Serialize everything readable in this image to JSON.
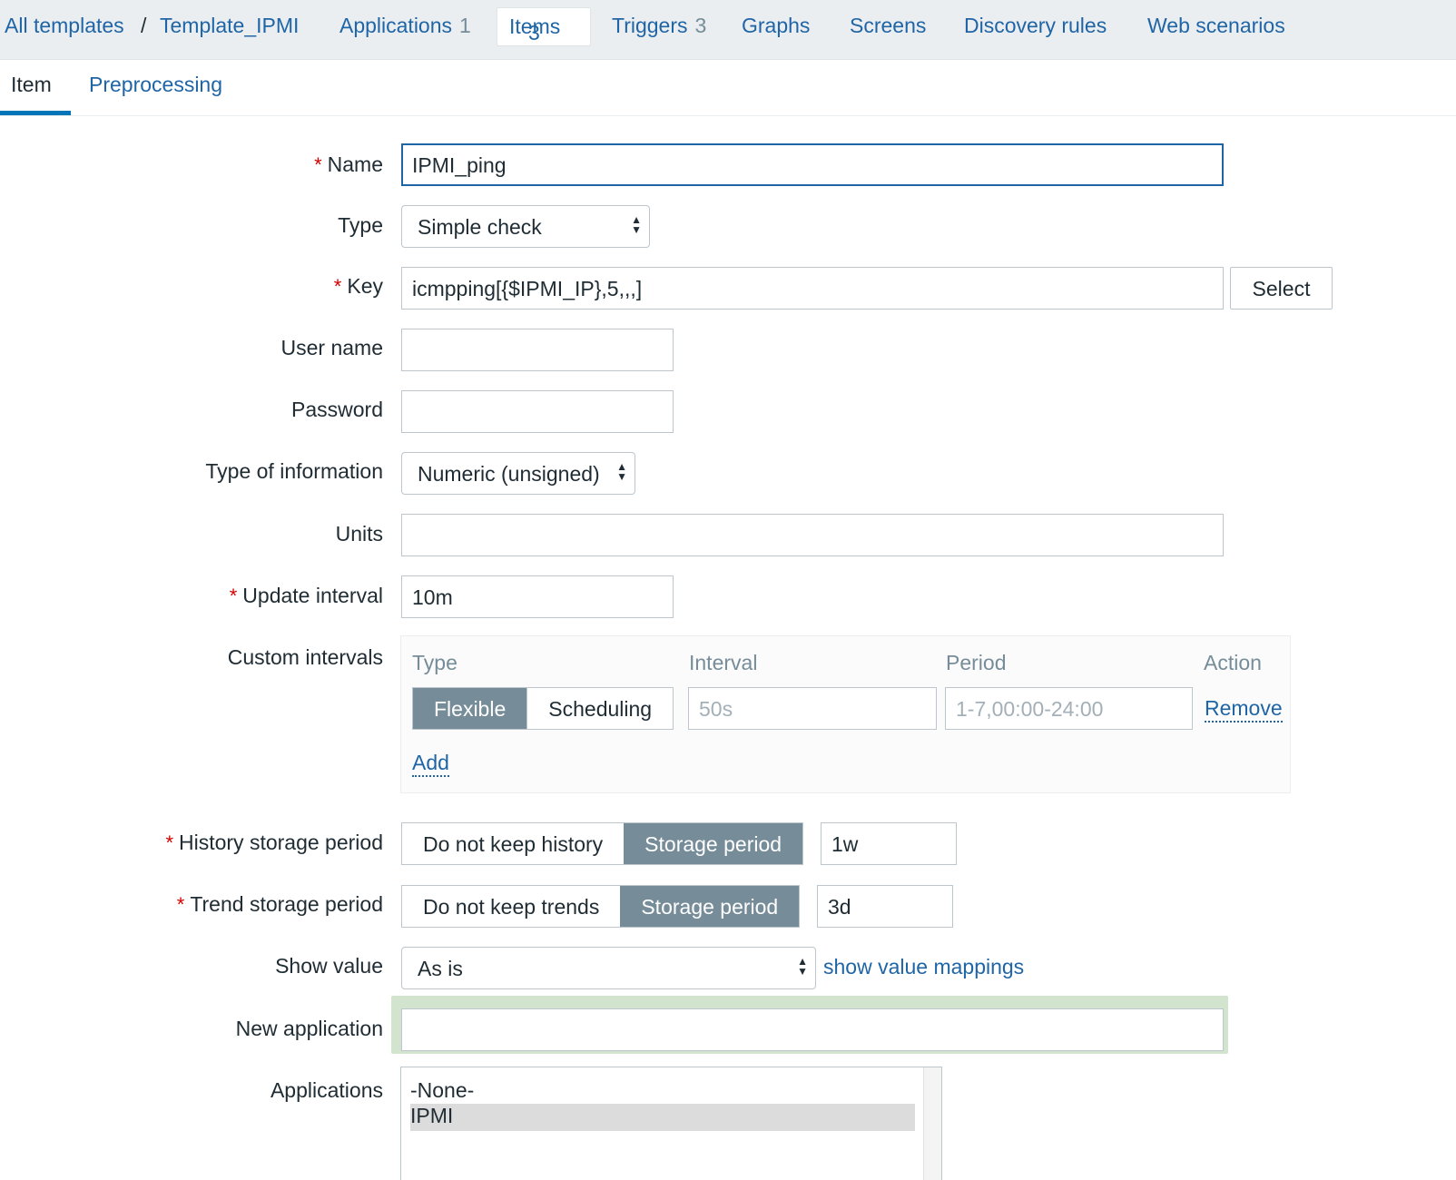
{
  "nav": {
    "all_templates": "All templates",
    "separator": "/",
    "template": "Template_IPMI",
    "applications": "Applications",
    "applications_count": "1",
    "items": "Items",
    "items_count": "3",
    "triggers": "Triggers",
    "triggers_count": "3",
    "graphs": "Graphs",
    "screens": "Screens",
    "discovery_rules": "Discovery rules",
    "web_scenarios": "Web scenarios"
  },
  "tabs": {
    "item": "Item",
    "preprocessing": "Preprocessing"
  },
  "form": {
    "required_mark": "*",
    "name_label": "Name",
    "name_value": "IPMI_ping",
    "type_label": "Type",
    "type_value": "Simple check",
    "key_label": "Key",
    "key_value": "icmpping[{$IPMI_IP},5,,,]",
    "select_button": "Select",
    "username_label": "User name",
    "username_value": "",
    "password_label": "Password",
    "password_value": "",
    "typeinfo_label": "Type of information",
    "typeinfo_value": "Numeric (unsigned)",
    "units_label": "Units",
    "units_value": "",
    "update_label": "Update interval",
    "update_value": "10m",
    "custom_label": "Custom intervals",
    "history_label": "History storage period",
    "history_no": "Do not keep history",
    "history_storage": "Storage period",
    "history_value": "1w",
    "trend_label": "Trend storage period",
    "trend_no": "Do not keep trends",
    "trend_storage": "Storage period",
    "trend_value": "3d",
    "showvalue_label": "Show value",
    "showvalue_value": "As is",
    "showvalue_link": "show value mappings",
    "newapp_label": "New application",
    "newapp_value": "",
    "apps_label": "Applications",
    "apps_options": [
      "-None-",
      "IPMI"
    ]
  },
  "custom_intervals": {
    "headers": {
      "type": "Type",
      "interval": "Interval",
      "period": "Period",
      "action": "Action"
    },
    "flexible": "Flexible",
    "scheduling": "Scheduling",
    "interval_placeholder": "50s",
    "period_placeholder": "1-7,00:00-24:00",
    "remove": "Remove",
    "add": "Add"
  },
  "colors": {
    "link": "#1f65a6",
    "segment_active": "#768d99",
    "required": "#d40000",
    "highlight_green": "#d2e4cd"
  }
}
